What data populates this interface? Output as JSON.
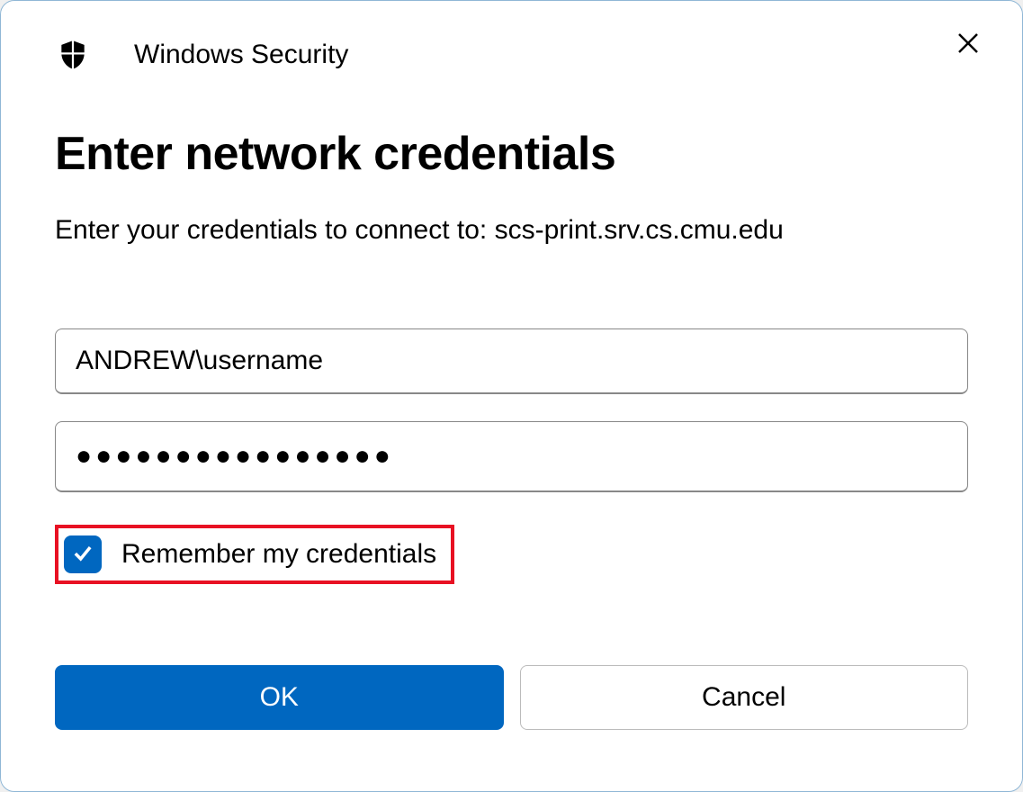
{
  "titlebar": {
    "title": "Windows Security"
  },
  "dialog": {
    "heading": "Enter network credentials",
    "subheading": "Enter your credentials to connect to: scs-print.srv.cs.cmu.edu"
  },
  "fields": {
    "username_value": "ANDREW\\username",
    "password_mask": "●●●●●●●●●●●●●●●●"
  },
  "checkbox": {
    "label": "Remember my credentials",
    "checked": true
  },
  "buttons": {
    "ok": "OK",
    "cancel": "Cancel"
  },
  "colors": {
    "accent": "#0067c0",
    "highlight_border": "#e81123"
  }
}
